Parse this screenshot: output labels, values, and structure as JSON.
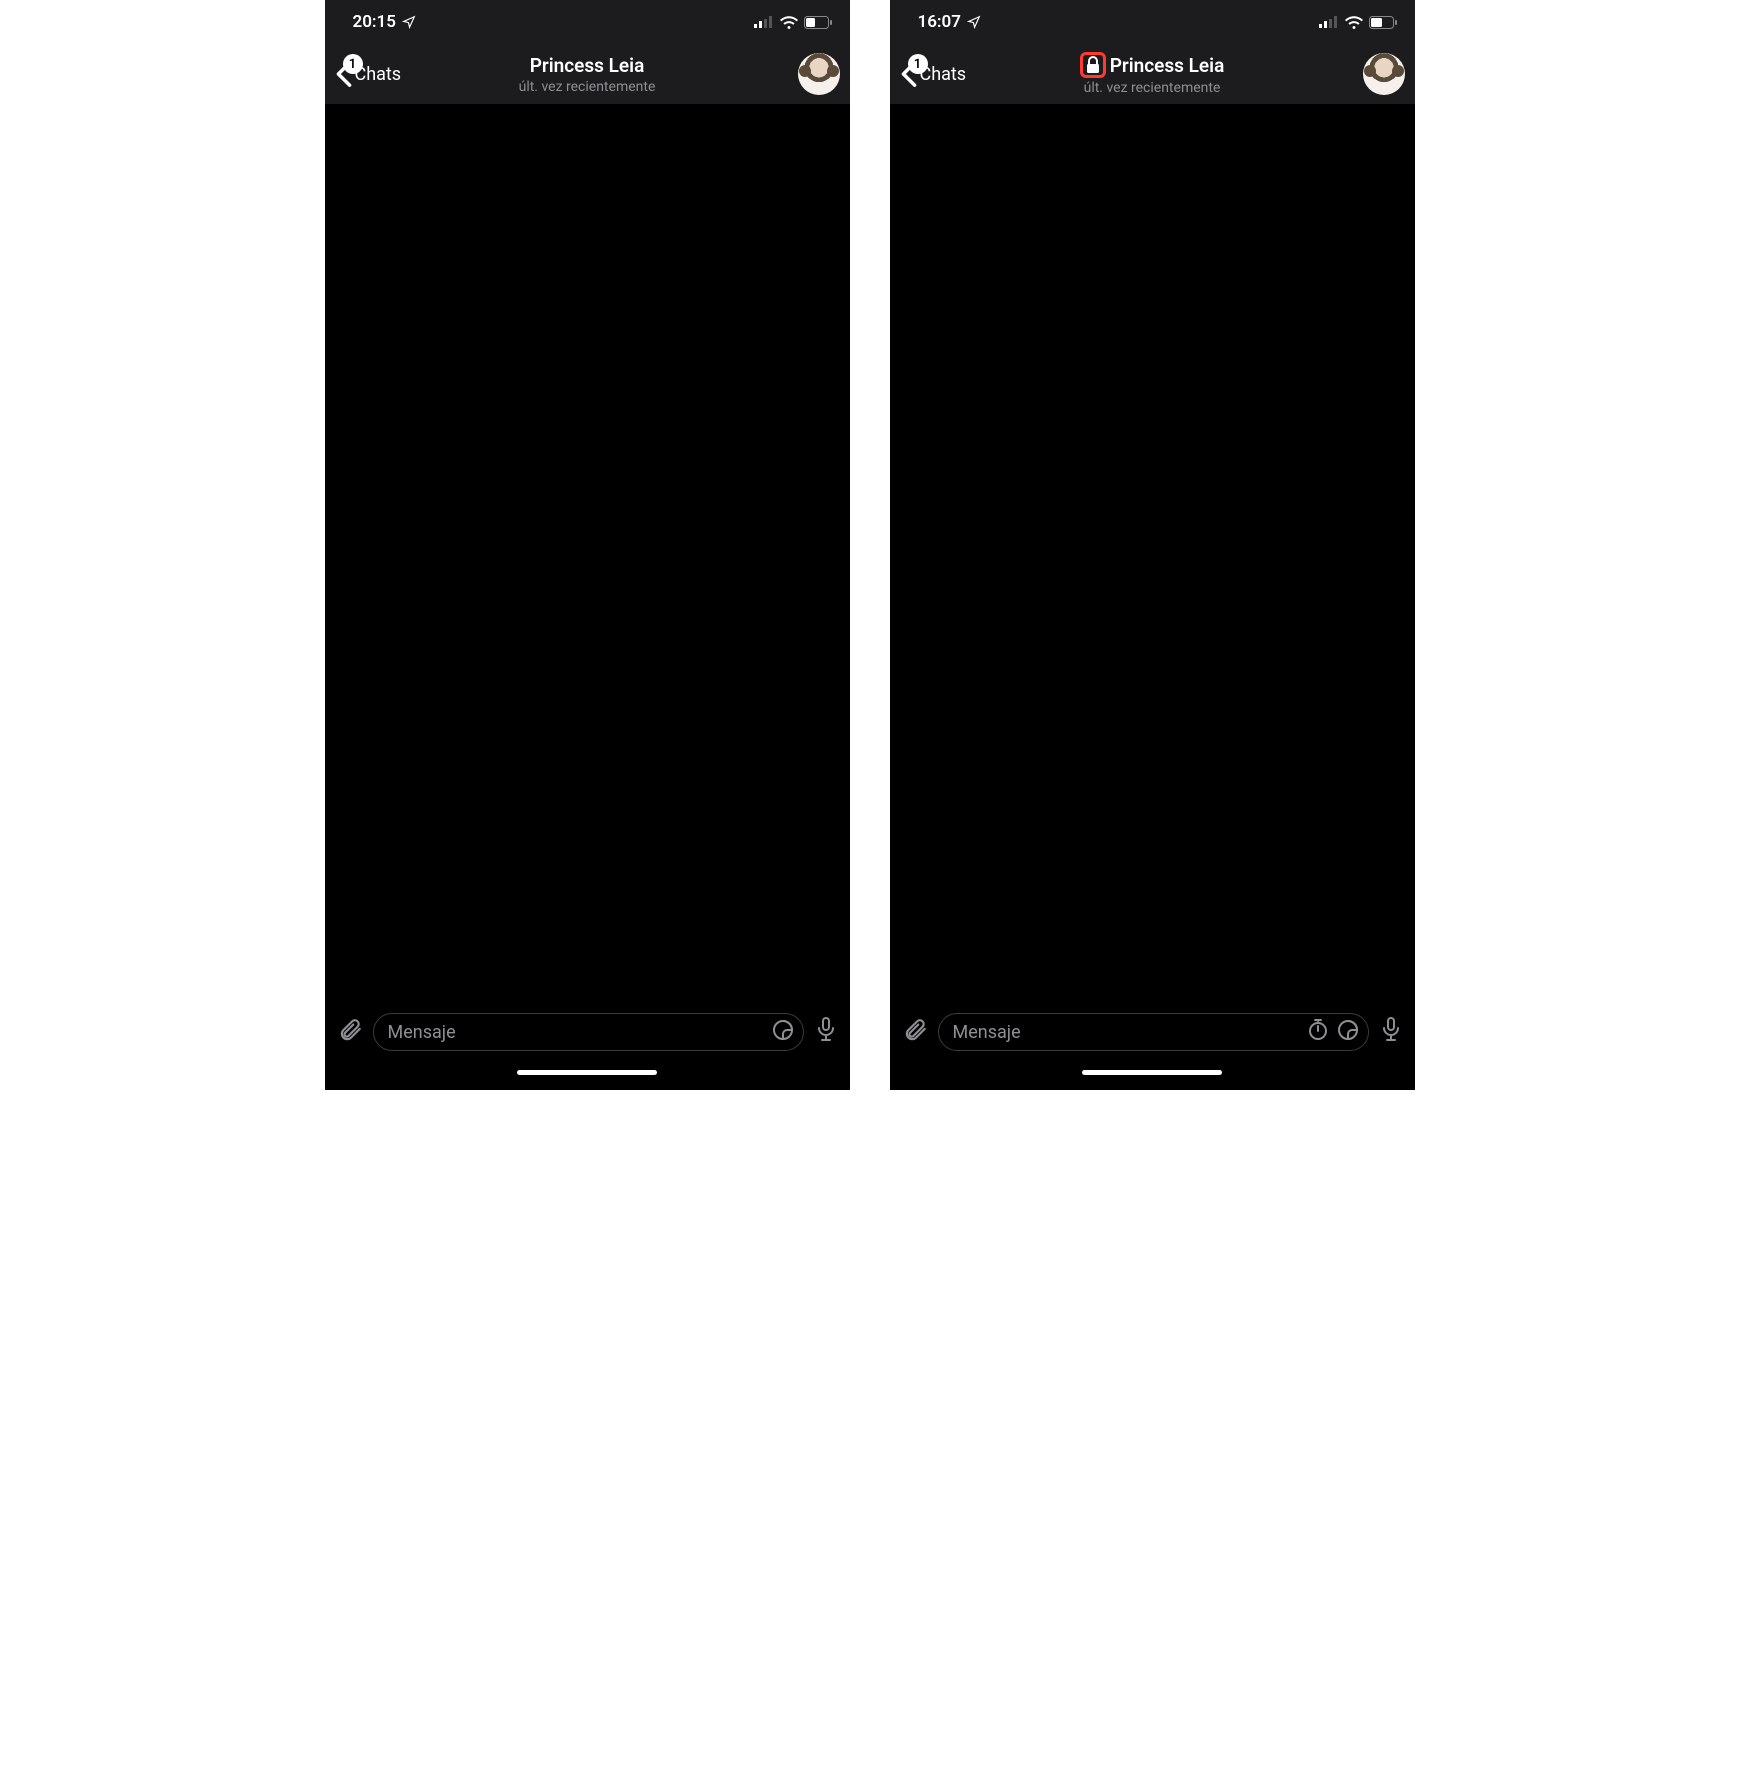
{
  "screens": [
    {
      "statusbar": {
        "time": "20:15"
      },
      "nav": {
        "back_label": "Chats",
        "badge": "1",
        "contact_name": "Princess Leia",
        "contact_status": "últ. vez recientemente",
        "show_lock": false
      },
      "input": {
        "placeholder": "Mensaje",
        "extra_timer_icon": false
      }
    },
    {
      "statusbar": {
        "time": "16:07"
      },
      "nav": {
        "back_label": "Chats",
        "badge": "1",
        "contact_name": "Princess Leia",
        "contact_status": "últ. vez recientemente",
        "show_lock": true
      },
      "input": {
        "placeholder": "Mensaje",
        "extra_timer_icon": true
      }
    }
  ]
}
